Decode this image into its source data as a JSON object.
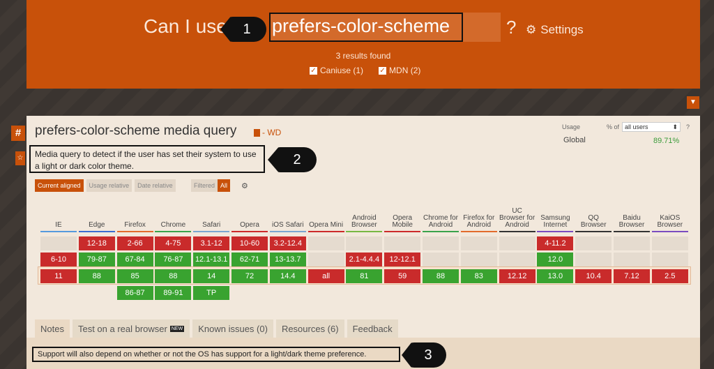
{
  "header": {
    "can_i_use": "Can I use",
    "search_value": "prefers-color-scheme",
    "question": "?",
    "settings": "Settings",
    "results": "3 results found",
    "filters": [
      "Caniuse (1)",
      "MDN (2)"
    ]
  },
  "callouts": [
    "1",
    "2",
    "3"
  ],
  "feature": {
    "title": "prefers-color-scheme media query",
    "spec": "- WD",
    "description": "Media query to detect if the user has set their system to use a light or dark color theme.",
    "usage_label": "Usage",
    "usage_of": "% of",
    "usage_select": "all users",
    "usage_help": "?",
    "global_label": "Global",
    "global_pct": "89.71%",
    "views": [
      "Current aligned",
      "Usage relative",
      "Date relative"
    ],
    "filtered": "Filtered",
    "all": "All"
  },
  "browsers": [
    {
      "name": "IE",
      "bar": "#5599dd",
      "cells": [
        null,
        "6-10",
        "11",
        null
      ],
      "kinds": [
        null,
        "n",
        "n",
        null
      ]
    },
    {
      "name": "Edge",
      "bar": "#3a6dd1",
      "cells": [
        "12-18",
        "79-87",
        "88",
        null
      ],
      "kinds": [
        "n",
        "y",
        "y",
        null
      ]
    },
    {
      "name": "Firefox",
      "bar": "#e26b2c",
      "cells": [
        "2-66",
        "67-84",
        "85",
        "86-87"
      ],
      "kinds": [
        "n",
        "y",
        "y",
        "y"
      ]
    },
    {
      "name": "Chrome",
      "bar": "#3aa34b",
      "cells": [
        "4-75",
        "76-87",
        "88",
        "89-91"
      ],
      "kinds": [
        "n",
        "y",
        "y",
        "y"
      ]
    },
    {
      "name": "Safari",
      "bar": "#7ba6d0",
      "cells": [
        "3.1-12",
        "12.1-13.1",
        "14",
        "TP"
      ],
      "kinds": [
        "n",
        "y",
        "y",
        "y"
      ]
    },
    {
      "name": "Opera",
      "bar": "#cc2a2a",
      "cells": [
        "10-60",
        "62-71",
        "72",
        null
      ],
      "kinds": [
        "n",
        "y",
        "y",
        null
      ]
    },
    {
      "name": "iOS Safari",
      "bar": "#7ba6d0",
      "cells": [
        "3.2-12.4",
        "13-13.7",
        "14.4",
        null
      ],
      "kinds": [
        "n",
        "y",
        "y",
        null
      ]
    },
    {
      "name": "Opera Mini",
      "bar": "#cc2a2a",
      "cells": [
        null,
        null,
        "all",
        null
      ],
      "kinds": [
        null,
        null,
        "n",
        null
      ]
    },
    {
      "name": "Android Browser",
      "bar": "#78b843",
      "cells": [
        null,
        "2.1-4.4.4",
        "81",
        null
      ],
      "kinds": [
        null,
        "n",
        "y",
        null
      ]
    },
    {
      "name": "Opera Mobile",
      "bar": "#cc2a2a",
      "cells": [
        null,
        "12-12.1",
        "59",
        null
      ],
      "kinds": [
        null,
        "n",
        "n",
        null
      ]
    },
    {
      "name": "Chrome for Android",
      "bar": "#3aa34b",
      "cells": [
        null,
        null,
        "88",
        null
      ],
      "kinds": [
        null,
        null,
        "y",
        null
      ]
    },
    {
      "name": "Firefox for Android",
      "bar": "#e26b2c",
      "cells": [
        null,
        null,
        "83",
        null
      ],
      "kinds": [
        null,
        null,
        "y",
        null
      ]
    },
    {
      "name": "UC Browser for Android",
      "bar": "#333333",
      "cells": [
        null,
        null,
        "12.12",
        null
      ],
      "kinds": [
        null,
        null,
        "n",
        null
      ]
    },
    {
      "name": "Samsung Internet",
      "bar": "#7a4cc0",
      "cells": [
        "4-11.2",
        "12.0",
        "13.0",
        null
      ],
      "kinds": [
        "n",
        "y",
        "y",
        null
      ]
    },
    {
      "name": "QQ Browser",
      "bar": "#333333",
      "cells": [
        null,
        null,
        "10.4",
        null
      ],
      "kinds": [
        null,
        null,
        "n",
        null
      ]
    },
    {
      "name": "Baidu Browser",
      "bar": "#333333",
      "cells": [
        null,
        null,
        "7.12",
        null
      ],
      "kinds": [
        null,
        null,
        "n",
        null
      ]
    },
    {
      "name": "KaiOS Browser",
      "bar": "#7a4cc0",
      "cells": [
        null,
        null,
        "2.5",
        null
      ],
      "kinds": [
        null,
        null,
        "n",
        null
      ]
    }
  ],
  "colors": {
    "supported": "#39a330",
    "unsupported": "#c92b2b",
    "empty": "#e5dbcf",
    "accent": "#c8510a"
  },
  "tabs": [
    "Notes",
    "Test on a real browser",
    "Known issues (0)",
    "Resources (6)",
    "Feedback"
  ],
  "new_badge": "NEW",
  "note": "Support will also depend on whether or not the OS has support for a light/dark theme preference."
}
